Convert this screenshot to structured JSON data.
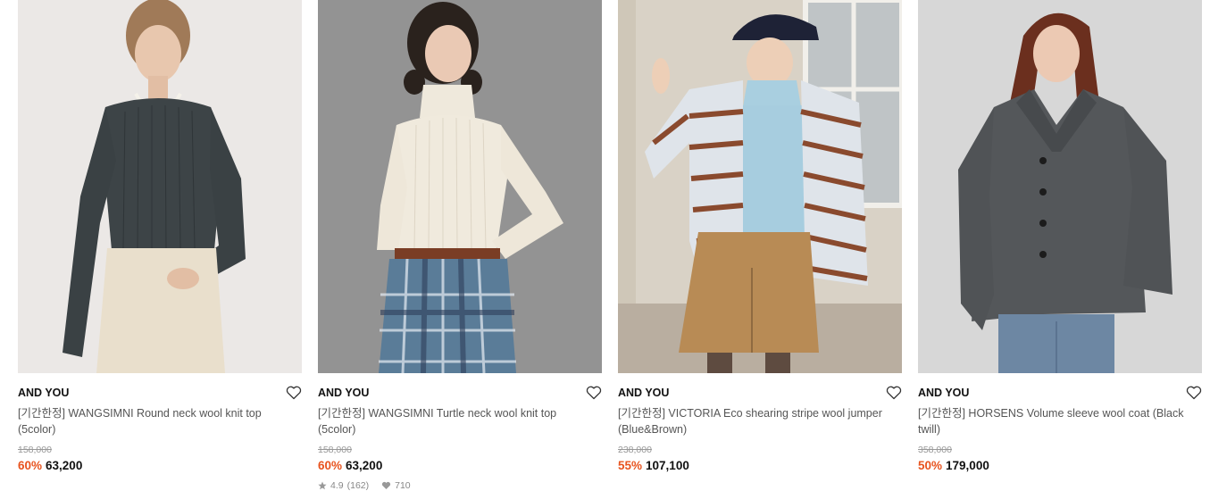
{
  "products": [
    {
      "brand": "AND YOU",
      "name": "[기간한정] WANGSIMNI Round neck wool knit top (5color)",
      "original_price": "158,000",
      "discount": "60%",
      "price": "63,200",
      "rating": "",
      "review_count": "",
      "likes": ""
    },
    {
      "brand": "AND YOU",
      "name": "[기간한정] WANGSIMNI Turtle neck wool knit top (5color)",
      "original_price": "158,000",
      "discount": "60%",
      "price": "63,200",
      "rating": "4.9",
      "review_count": "(162)",
      "likes": "710"
    },
    {
      "brand": "AND YOU",
      "name": "[기간한정] VICTORIA Eco shearing stripe wool jumper (Blue&Brown)",
      "original_price": "238,000",
      "discount": "55%",
      "price": "107,100",
      "rating": "",
      "review_count": "",
      "likes": ""
    },
    {
      "brand": "AND YOU",
      "name": "[기간한정] HORSENS Volume sleeve wool coat (Black twill)",
      "original_price": "358,000",
      "discount": "50%",
      "price": "179,000",
      "rating": "",
      "review_count": "",
      "likes": ""
    }
  ],
  "colors": {
    "discount": "#e8541f",
    "brand": "#111111",
    "muted": "#999999"
  },
  "icons": {
    "wishlist": "heart-outline-icon",
    "rating": "star-icon",
    "likes": "heart-filled-icon"
  }
}
